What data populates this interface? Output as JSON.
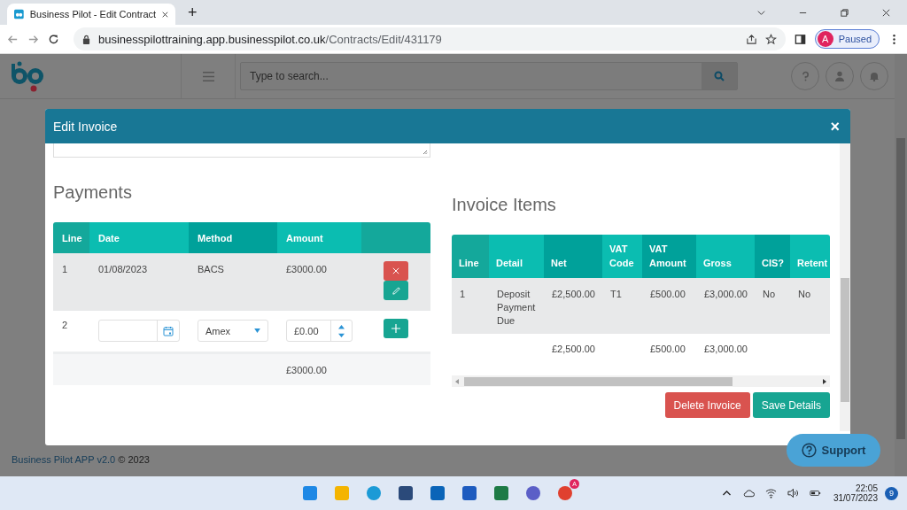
{
  "browser": {
    "tab_title": "Business Pilot - Edit Contract",
    "new_tab": "+",
    "url_host": "businesspilottraining.app.businesspilot.co.uk",
    "url_path": "/Contracts/Edit/431179",
    "profile": {
      "initial": "A",
      "status": "Paused"
    }
  },
  "app": {
    "search": {
      "placeholder": "Type to search..."
    },
    "footer": {
      "brand": "Business Pilot APP v2.0",
      "rest": "© 2023"
    },
    "support": "Support"
  },
  "modal": {
    "title": "Edit Invoice",
    "close": "×",
    "payments": {
      "title": "Payments",
      "columns": [
        "Line",
        "Date",
        "Method",
        "Amount"
      ],
      "rows": [
        {
          "kind": "saved",
          "line": "1",
          "date": "01/08/2023",
          "method": "BACS",
          "amount": "£3000.00"
        },
        {
          "kind": "new",
          "line": "2",
          "method": "Amex",
          "amount": "£0.00"
        }
      ],
      "total": "£3000.00"
    },
    "invoice_items": {
      "title": "Invoice Items",
      "columns": [
        "Line",
        "Detail",
        "Net",
        "VAT Code",
        "VAT Amount",
        "Gross",
        "CIS?",
        "Retent"
      ],
      "rows": [
        [
          "1",
          "Deposit Payment Due",
          "£2,500.00",
          "T1",
          "£500.00",
          "£3,000.00",
          "No",
          "No"
        ]
      ],
      "totals": {
        "net": "£2,500.00",
        "vat_amount": "£500.00",
        "gross": "£3,000.00"
      }
    },
    "buttons": [
      {
        "kind": "danger",
        "label": "Delete Invoice"
      },
      {
        "kind": "primary",
        "label": "Save Details"
      }
    ]
  },
  "taskbar": {
    "chrome_badge": "A",
    "time": "22:05",
    "date": "31/07/2023",
    "notifications": "9"
  }
}
